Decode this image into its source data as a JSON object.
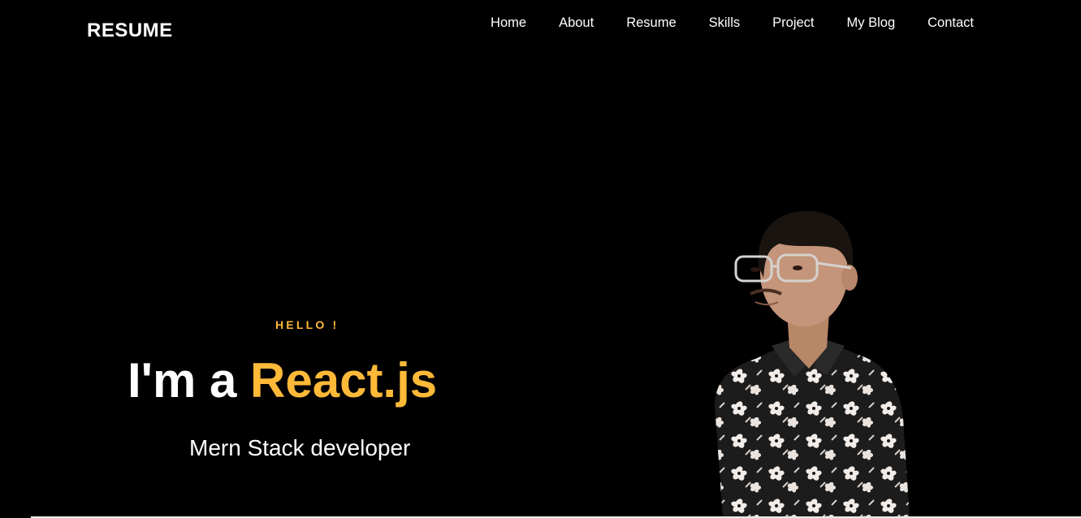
{
  "header": {
    "brand": "RESUME",
    "nav": [
      "Home",
      "About",
      "Resume",
      "Skills",
      "Project",
      "My Blog",
      "Contact"
    ]
  },
  "hero": {
    "greeting": "HELLO !",
    "headline_lead": "I'm a",
    "headline_accent": "React.js",
    "subtitle": "Mern Stack developer",
    "portrait_icon": "person-photo"
  },
  "colors": {
    "background": "#000000",
    "accent": "#ffb938",
    "text": "#ffffff"
  }
}
